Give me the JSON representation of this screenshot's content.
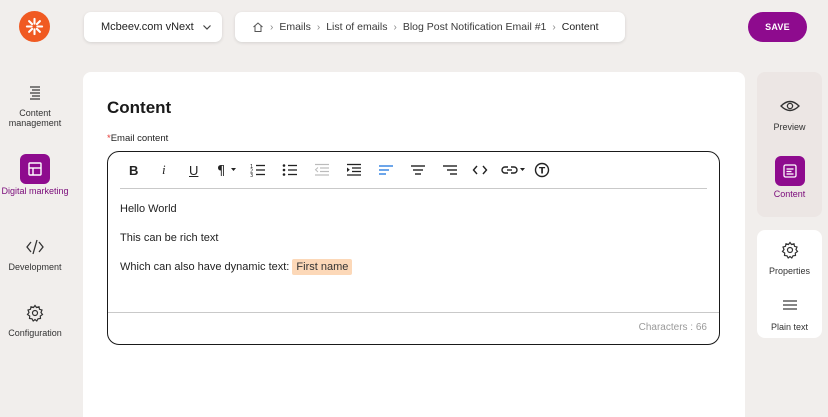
{
  "header": {
    "site_selector": "Mcbeev.com vNext",
    "breadcrumb": [
      "Emails",
      "List of emails",
      "Blog Post Notification Email #1",
      "Content"
    ],
    "save_label": "SAVE"
  },
  "left_nav": [
    {
      "label": "Content management",
      "icon": "content-management-icon"
    },
    {
      "label": "Digital marketing",
      "icon": "digital-marketing-icon",
      "active": true
    },
    {
      "label": "Development",
      "icon": "code-icon"
    },
    {
      "label": "Configuration",
      "icon": "gear-icon"
    }
  ],
  "main": {
    "title": "Content",
    "field_label": "Email content",
    "required_marker": "*",
    "editor": {
      "lines": [
        "Hello World",
        "This can be rich text",
        "Which can also have dynamic text:"
      ],
      "dynamic_token": "First name",
      "char_count": "Characters : 66"
    }
  },
  "right_panel": {
    "top": [
      {
        "label": "Preview",
        "icon": "eye-icon"
      },
      {
        "label": "Content",
        "icon": "content-icon",
        "active": true
      }
    ],
    "bottom": [
      {
        "label": "Properties",
        "icon": "gear-icon"
      },
      {
        "label": "Plain text",
        "icon": "lines-icon"
      }
    ]
  },
  "colors": {
    "accent": "#8e0b8e",
    "logo": "#f05a22",
    "token": "#fcd8b8",
    "background": "#f1eeec"
  }
}
